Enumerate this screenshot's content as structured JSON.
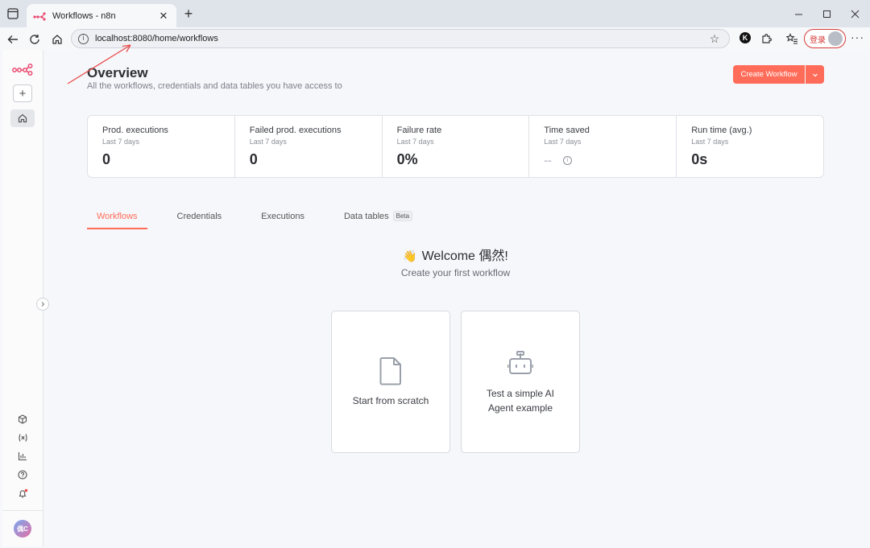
{
  "browser": {
    "tab_title": "Workflows - n8n",
    "url": "localhost:8080/home/workflows",
    "login_label": "登录",
    "ext_k_label": "K",
    "icons": [
      "sidebar-toggle-icon",
      "n8n-favicon",
      "close-icon",
      "plus-icon",
      "minimize-icon",
      "maximize-icon",
      "window-close-icon",
      "back-icon",
      "refresh-icon",
      "home-icon",
      "info-icon",
      "star-icon",
      "extension-icon",
      "favorites-icon",
      "more-icon"
    ]
  },
  "sidebar": {
    "avatar_initials": "偶C",
    "icons": [
      "n8n-logo-icon",
      "plus-icon",
      "home-icon",
      "expand-chevron-icon",
      "templates-icon",
      "variables-icon",
      "insights-icon",
      "help-icon",
      "bell-icon"
    ]
  },
  "overview": {
    "title": "Overview",
    "subtitle": "All the workflows, credentials and data tables you have access to",
    "create_label": "Create Workflow"
  },
  "stats": [
    {
      "label": "Prod. executions",
      "period": "Last 7 days",
      "value": "0"
    },
    {
      "label": "Failed prod. executions",
      "period": "Last 7 days",
      "value": "0"
    },
    {
      "label": "Failure rate",
      "period": "Last 7 days",
      "value": "0%"
    },
    {
      "label": "Time saved",
      "period": "Last 7 days",
      "value": "--"
    },
    {
      "label": "Run time (avg.)",
      "period": "Last 7 days",
      "value": "0s"
    }
  ],
  "tabs": [
    {
      "label": "Workflows"
    },
    {
      "label": "Credentials"
    },
    {
      "label": "Executions"
    },
    {
      "label": "Data tables",
      "badge": "Beta"
    }
  ],
  "welcome": {
    "emoji": "👋",
    "title": "Welcome 偶然!",
    "subtitle": "Create your first workflow"
  },
  "cards": [
    {
      "label": "Start from scratch"
    },
    {
      "label": "Test a simple AI Agent example"
    }
  ],
  "colors": {
    "accent": "#ff6d5a",
    "annotation_arrow": "#e84a4a"
  }
}
